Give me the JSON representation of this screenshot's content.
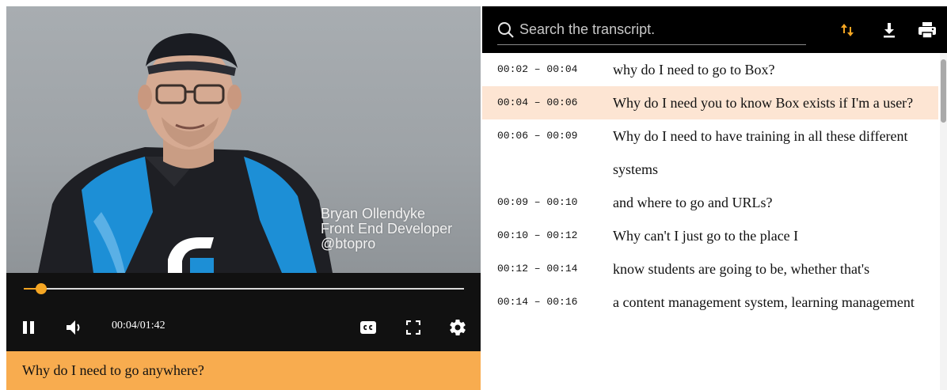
{
  "video": {
    "overlay_name": "Bryan Ollendyke",
    "overlay_role": "Front End Developer",
    "overlay_handle": "@btopro",
    "progress_fraction": 0.04
  },
  "controls": {
    "play_pause_icon": "pause-icon",
    "volume_icon": "volume-icon",
    "time": "00:04/01:42",
    "cc_icon": "closed-captions-icon",
    "fullscreen_icon": "fullscreen-icon",
    "settings_icon": "gear-icon",
    "accent_color": "#f5a623"
  },
  "caption": {
    "text": "Why do I need to go anywhere?",
    "background": "#f8ac4f"
  },
  "transcript": {
    "search_placeholder": "Search the transcript.",
    "search_value": "",
    "header_icons": [
      "sort-arrows-icon",
      "download-icon",
      "print-icon"
    ],
    "highlight_color": "#fde5d3",
    "cues": [
      {
        "time": "00:02 – 00:04",
        "text": "why do I need to go to Box?",
        "active": false
      },
      {
        "time": "00:04 – 00:06",
        "text": "Why do I need you to know Box exists if I'm a user?",
        "active": true
      },
      {
        "time": "00:06 – 00:09",
        "text": "Why do I need to have training in all these different systems",
        "active": false
      },
      {
        "time": "00:09 – 00:10",
        "text": "and where to go and URLs?",
        "active": false
      },
      {
        "time": "00:10 – 00:12",
        "text": "Why can't I just go to the place I",
        "active": false
      },
      {
        "time": "00:12 – 00:14",
        "text": "know students are going to be, whether that's",
        "active": false
      },
      {
        "time": "00:14 – 00:16",
        "text": "a content management system, learning management",
        "active": false
      }
    ]
  }
}
